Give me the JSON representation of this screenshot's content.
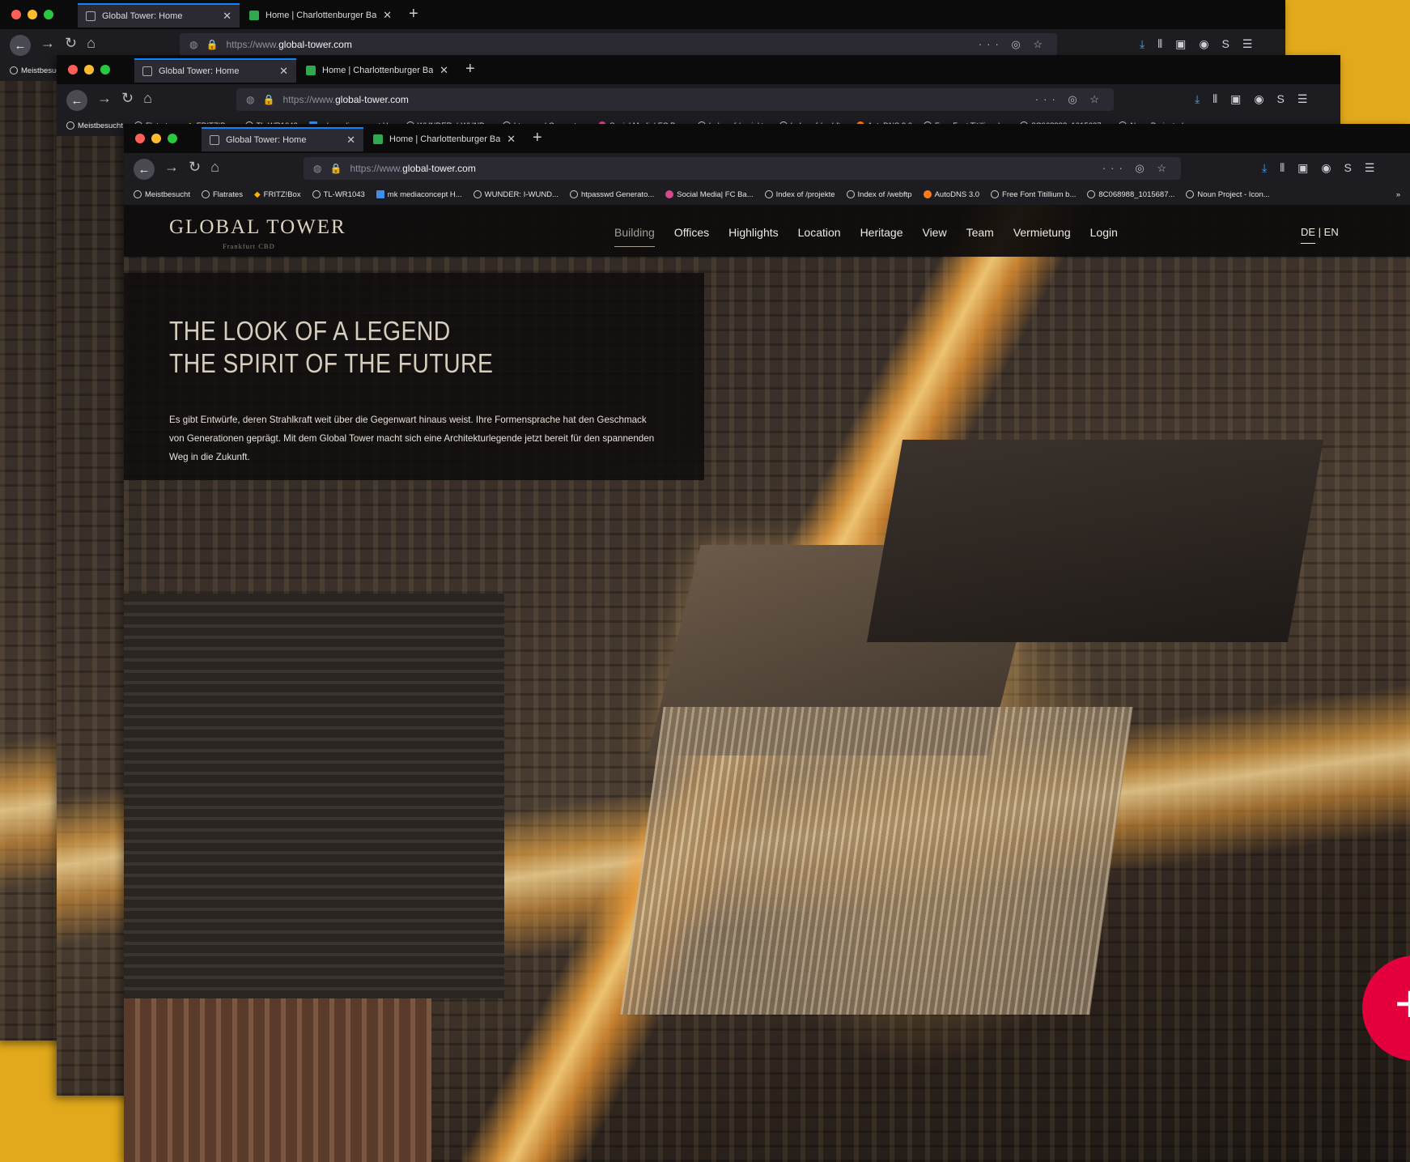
{
  "browser": {
    "tabs": [
      {
        "title": "Global Tower: Home"
      },
      {
        "title": "Home | Charlottenburger Bau..."
      }
    ],
    "url": {
      "prefix": "https://www.",
      "domain": "global-tower.com"
    },
    "bookmarks": [
      "Meistbesucht",
      "Flatrates",
      "FRITZ!Box",
      "TL-WR1043",
      "mk mediaconcept H...",
      "WUNDER: I-WUND...",
      "htpasswd Generato...",
      "Social Media| FC Ba...",
      "Index of /projekte",
      "Index of /webftp",
      "AutoDNS 3.0",
      "Free Font Titillium b...",
      "8C068988_1015687...",
      "Noun Project - Icon..."
    ],
    "overflow": "»"
  },
  "site": {
    "logo": {
      "title": "GLOBAL TOWER",
      "subtitle": "Frankfurt CBD"
    },
    "nav": [
      "Building",
      "Offices",
      "Highlights",
      "Location",
      "Heritage",
      "View",
      "Team",
      "Vermietung",
      "Login"
    ],
    "lang": {
      "de": "DE",
      "sep": " | ",
      "en": "EN"
    },
    "hero": {
      "line1": "THE LOOK OF A LEGEND",
      "line2": "THE SPIRIT OF THE FUTURE",
      "body": "Es gibt Entwürfe, deren Strahlkraft weit über die Gegenwart hinaus weist. Ihre Formensprache hat den Geschmack von Generationen geprägt. Mit dem Global Tower macht sich eine Architekturlegende jetzt bereit für den spannenden Weg in die Zukunft."
    }
  },
  "colors": {
    "background": "#e2a91c",
    "accent_fab": "#e3003d",
    "tab_highlight": "#0a84ff"
  },
  "icons": [
    "back-icon",
    "forward-icon",
    "reload-icon",
    "home-icon",
    "shield-icon",
    "lock-icon",
    "star-icon",
    "download-icon",
    "library-icon",
    "sidebar-icon",
    "menu-icon",
    "plus-icon"
  ]
}
